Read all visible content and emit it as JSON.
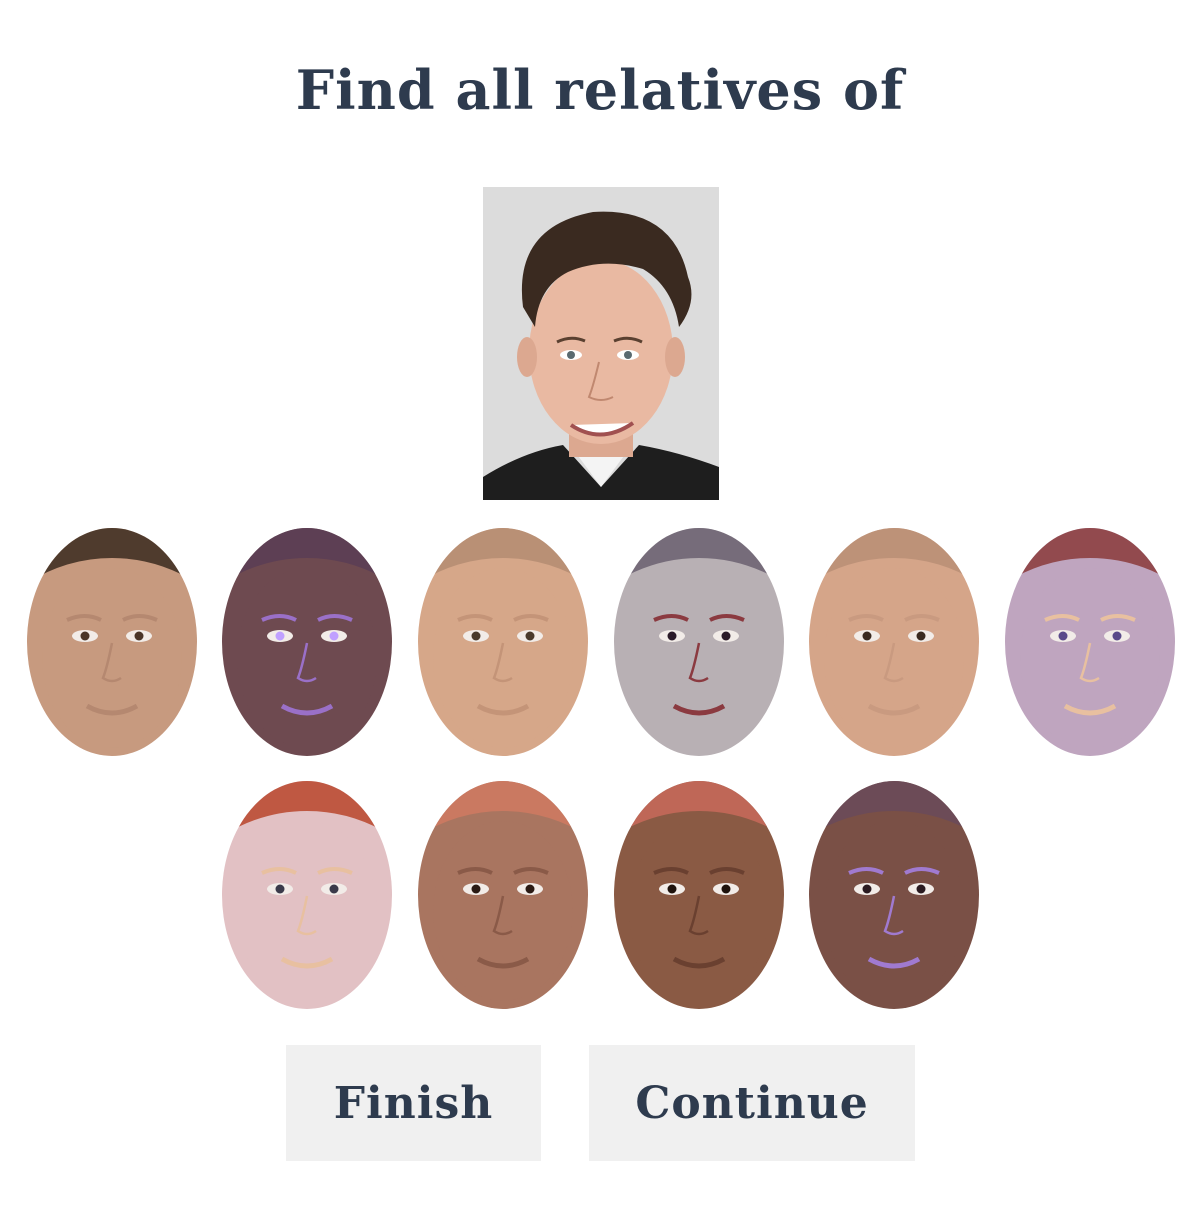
{
  "prompt": {
    "title": "Find all relatives of"
  },
  "target": {
    "colors": {
      "bg": "#dcdcdc",
      "skin": "#e9b9a2",
      "hair": "#3a2a20",
      "suit": "#1e1e1e"
    }
  },
  "faces": [
    {
      "id": "face-1",
      "skin": "#c79a7f",
      "hair": "#3a2a1e",
      "accent": "#b58870",
      "eye": "#4a3528"
    },
    {
      "id": "face-2",
      "skin": "#6e4a50",
      "hair": "#5a3d55",
      "accent": "#9a70c8",
      "eye": "#c0a0ff"
    },
    {
      "id": "face-3",
      "skin": "#d6a789",
      "hair": "#b48c72",
      "accent": "#c49478",
      "eye": "#4a3a2c"
    },
    {
      "id": "face-4",
      "skin": "#b8b0b4",
      "hair": "#6a6070",
      "accent": "#8b3a40",
      "eye": "#2a1a28"
    },
    {
      "id": "face-5",
      "skin": "#d5a589",
      "hair": "#b88e76",
      "accent": "#c99a80",
      "eye": "#3a2a20"
    },
    {
      "id": "face-6",
      "skin": "#bfa5bf",
      "hair": "#8a3a3a",
      "accent": "#e8c0a0",
      "eye": "#5a4a8a"
    },
    {
      "id": "face-7",
      "skin": "#e2c1c4",
      "hair": "#b8452c",
      "accent": "#e8c0a0",
      "eye": "#3a3a4a"
    },
    {
      "id": "face-8",
      "skin": "#a97560",
      "hair": "#d07a62",
      "accent": "#8a5a48",
      "eye": "#2a1a14"
    },
    {
      "id": "face-9",
      "skin": "#8a5a44",
      "hair": "#c86a5a",
      "accent": "#6a4030",
      "eye": "#1e120c"
    },
    {
      "id": "face-10",
      "skin": "#7a5046",
      "hair": "#6a4a5a",
      "accent": "#a07ad0",
      "eye": "#2a1a20"
    }
  ],
  "buttons": {
    "finish_label": "Finish",
    "continue_label": "Continue"
  }
}
